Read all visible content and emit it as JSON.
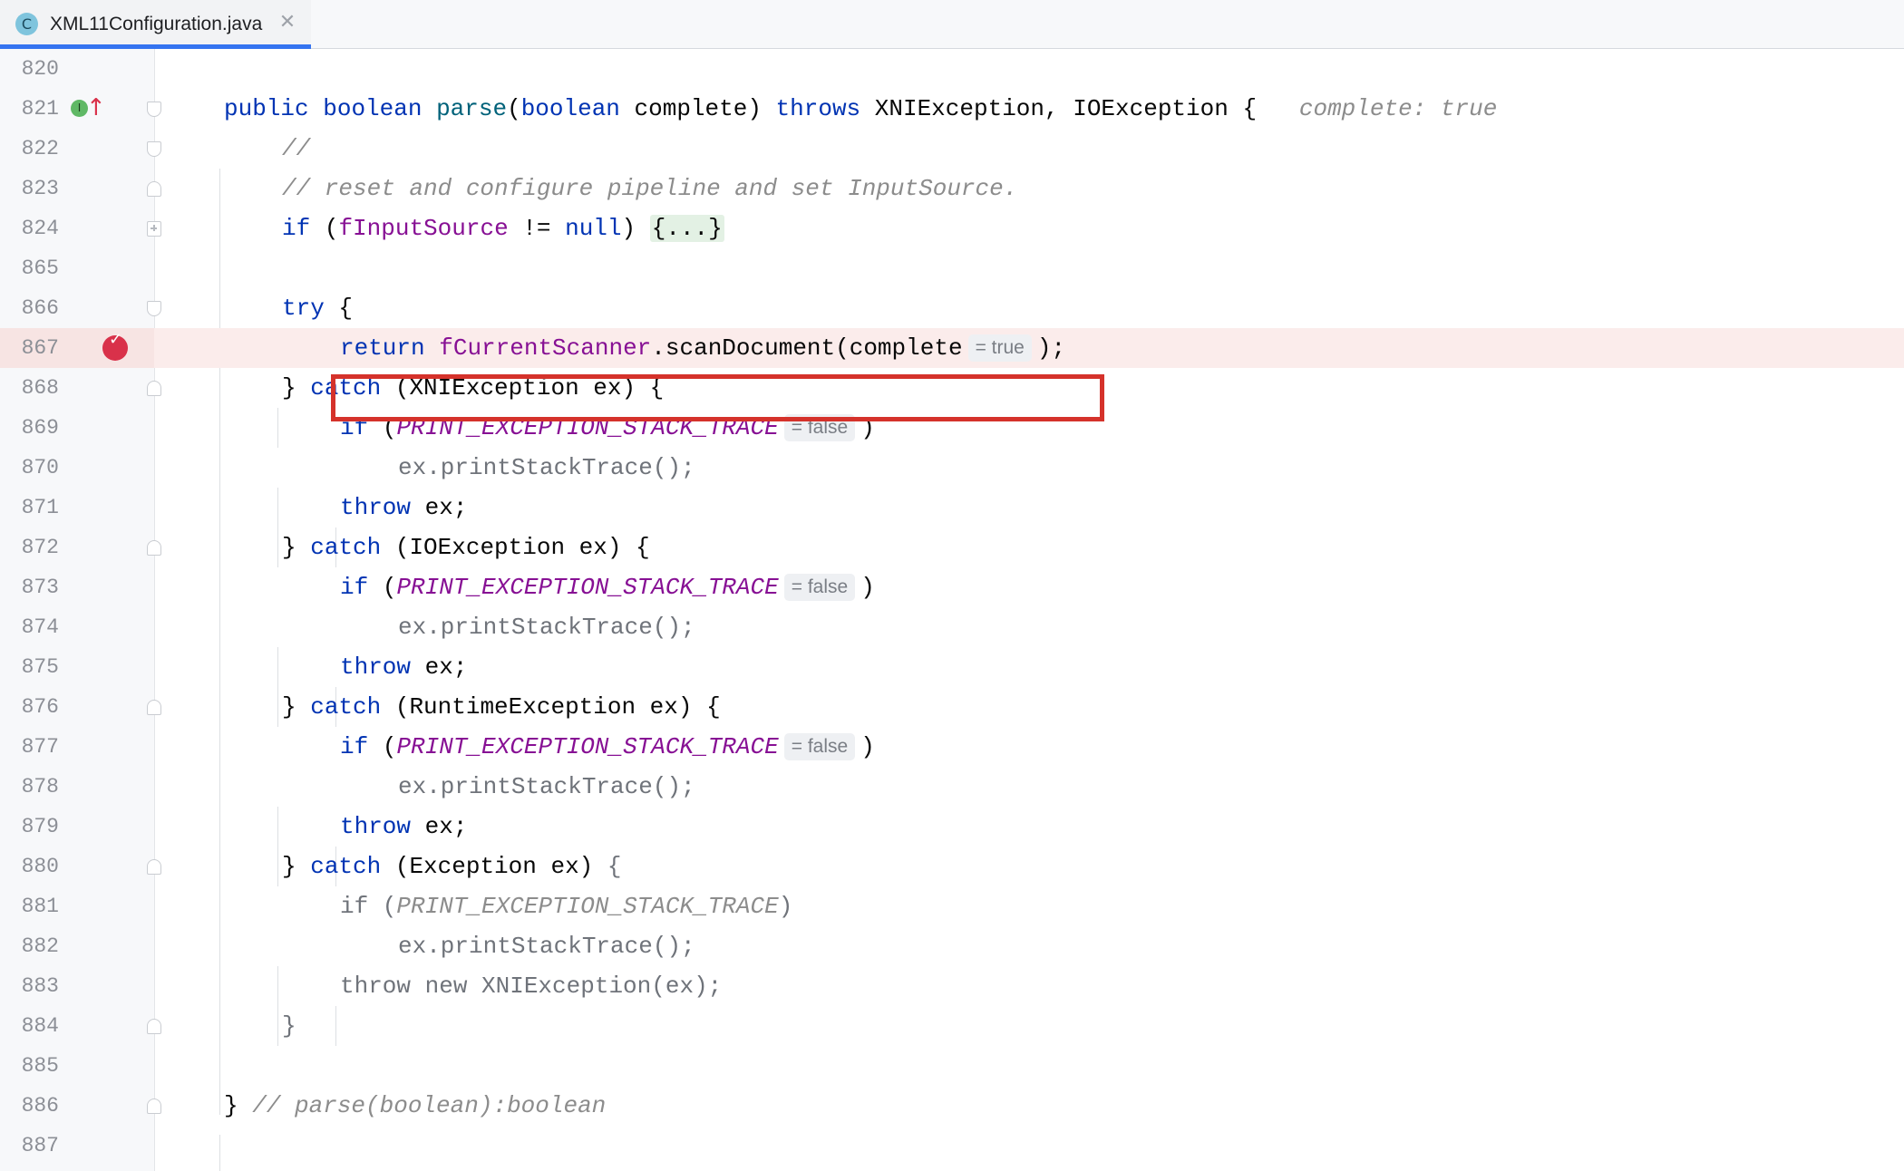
{
  "tab": {
    "icon_letter": "C",
    "file_name": "XML11Configuration.java",
    "close_glyph": "✕"
  },
  "lines": [
    {
      "num": "820"
    },
    {
      "num": "821"
    },
    {
      "num": "822"
    },
    {
      "num": "823"
    },
    {
      "num": "824"
    },
    {
      "num": "865"
    },
    {
      "num": "866"
    },
    {
      "num": "867"
    },
    {
      "num": "868"
    },
    {
      "num": "869"
    },
    {
      "num": "870"
    },
    {
      "num": "871"
    },
    {
      "num": "872"
    },
    {
      "num": "873"
    },
    {
      "num": "874"
    },
    {
      "num": "875"
    },
    {
      "num": "876"
    },
    {
      "num": "877"
    },
    {
      "num": "878"
    },
    {
      "num": "879"
    },
    {
      "num": "880"
    },
    {
      "num": "881"
    },
    {
      "num": "882"
    },
    {
      "num": "883"
    },
    {
      "num": "884"
    },
    {
      "num": "885"
    },
    {
      "num": "886"
    },
    {
      "num": "887"
    }
  ],
  "code": {
    "l821": {
      "public": "public",
      "boolean1": "boolean",
      "parse": "parse",
      "open": "(",
      "boolean2": "boolean",
      "complete": " complete) ",
      "throws": "throws",
      "rest": " XNIException, IOException {",
      "hint": "complete: true"
    },
    "l822": {
      "comment": "//"
    },
    "l823": {
      "comment": "// reset and configure pipeline and set InputSource."
    },
    "l824": {
      "if": "if",
      "open": " (",
      "field": "fInputSource",
      "neq": " != ",
      "null": "null",
      "close": ") ",
      "folded": "{...}"
    },
    "l866": {
      "try": "try",
      "brace": " {"
    },
    "l867": {
      "return": "return",
      "field": "fCurrentScanner",
      "dot": ".",
      "method": "scanDocument",
      "args": "(complete",
      "inlay": "= true",
      "end": ");"
    },
    "l868": {
      "brace": "} ",
      "catch": "catch",
      "rest": " (XNIException ex) {"
    },
    "l869": {
      "if": "if",
      "open": " (",
      "const": "PRINT_EXCEPTION_STACK_TRACE",
      "inlay": "= false",
      "close": ")"
    },
    "l870": {
      "stmt": "ex.printStackTrace();"
    },
    "l871": {
      "throw": "throw",
      "rest": " ex;"
    },
    "l872": {
      "brace": "} ",
      "catch": "catch",
      "rest": " (IOException ex) {"
    },
    "l873": {
      "if": "if",
      "open": " (",
      "const": "PRINT_EXCEPTION_STACK_TRACE",
      "inlay": "= false",
      "close": ")"
    },
    "l874": {
      "stmt": "ex.printStackTrace();"
    },
    "l875": {
      "throw": "throw",
      "rest": " ex;"
    },
    "l876": {
      "brace": "} ",
      "catch": "catch",
      "rest": " (RuntimeException ex) {"
    },
    "l877": {
      "if": "if",
      "open": " (",
      "const": "PRINT_EXCEPTION_STACK_TRACE",
      "inlay": "= false",
      "close": ")"
    },
    "l878": {
      "stmt": "ex.printStackTrace();"
    },
    "l879": {
      "throw": "throw",
      "rest": " ex;"
    },
    "l880": {
      "brace": "} ",
      "catch": "catch",
      "rest": " (Exception ex) ",
      "open_brace": "{"
    },
    "l881": {
      "if": "if (",
      "const": "PRINT_EXCEPTION_STACK_TRACE",
      "close": ")"
    },
    "l882": {
      "stmt": "ex.printStackTrace();"
    },
    "l883": {
      "stmt": "throw new XNIException(ex);"
    },
    "l884": {
      "brace": "}"
    },
    "l886": {
      "brace": "} ",
      "comment": "// parse(boolean):boolean"
    }
  },
  "colors": {
    "keyword": "#0033b3",
    "method": "#00627a",
    "field": "#871094",
    "comment": "#8c8c8c",
    "current_line": "#fbeceb",
    "highlight_border": "#d5322b",
    "breakpoint": "#d9314a",
    "tab_underline": "#3574f0"
  },
  "icons": {
    "tab_icon": "java-class-icon",
    "close": "close-icon",
    "implements": "implements-method-icon",
    "override_arrow": "up-arrow-icon",
    "breakpoint": "breakpoint-hit-icon"
  }
}
